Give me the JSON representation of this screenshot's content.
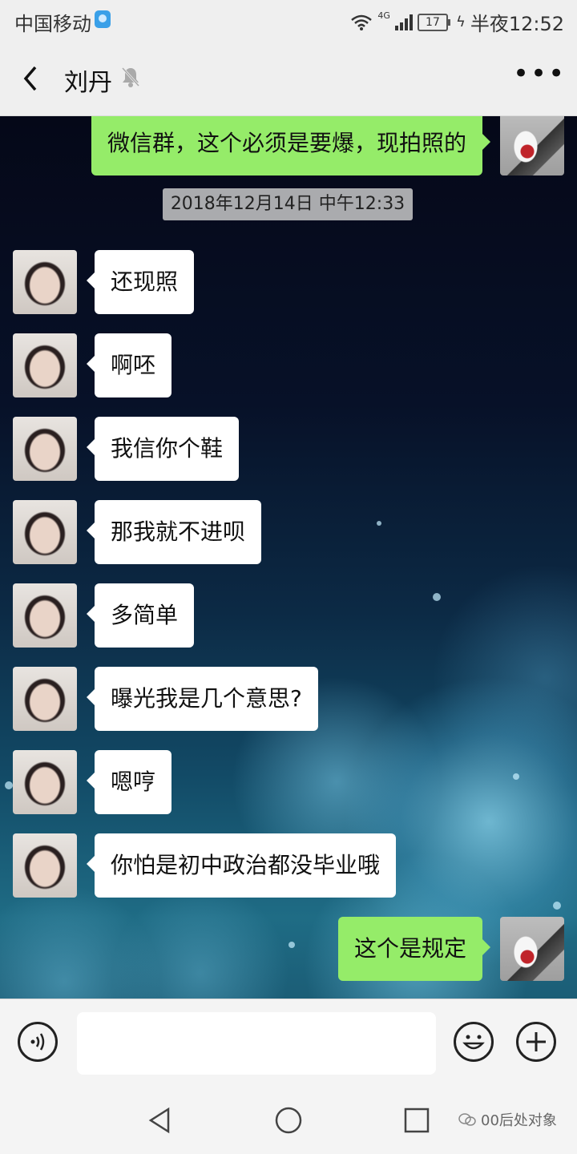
{
  "status_bar": {
    "carrier": "中国移动",
    "network": "4G",
    "battery": "17",
    "time": "半夜12:52"
  },
  "header": {
    "title": "刘丹"
  },
  "chat": {
    "timestamp": "2018年12月14日 中午12:33",
    "messages": [
      {
        "side": "right",
        "text": "微信群，这个必须是要爆，现拍照的"
      },
      {
        "side": "left",
        "text": "还现照"
      },
      {
        "side": "left",
        "text": "啊呸"
      },
      {
        "side": "left",
        "text": "我信你个鞋"
      },
      {
        "side": "left",
        "text": "那我就不进呗"
      },
      {
        "side": "left",
        "text": "多简单"
      },
      {
        "side": "left",
        "text": "曝光我是几个意思?"
      },
      {
        "side": "left",
        "text": "嗯哼"
      },
      {
        "side": "left",
        "text": "你怕是初中政治都没毕业哦"
      },
      {
        "side": "right",
        "text": "这个是规定"
      }
    ]
  },
  "input_bar": {
    "text_value": ""
  },
  "watermark": {
    "text": "00后处对象"
  },
  "colors": {
    "bubble_sent": "#95ec69",
    "bubble_received": "#ffffff",
    "bar_bg": "#efefef"
  }
}
